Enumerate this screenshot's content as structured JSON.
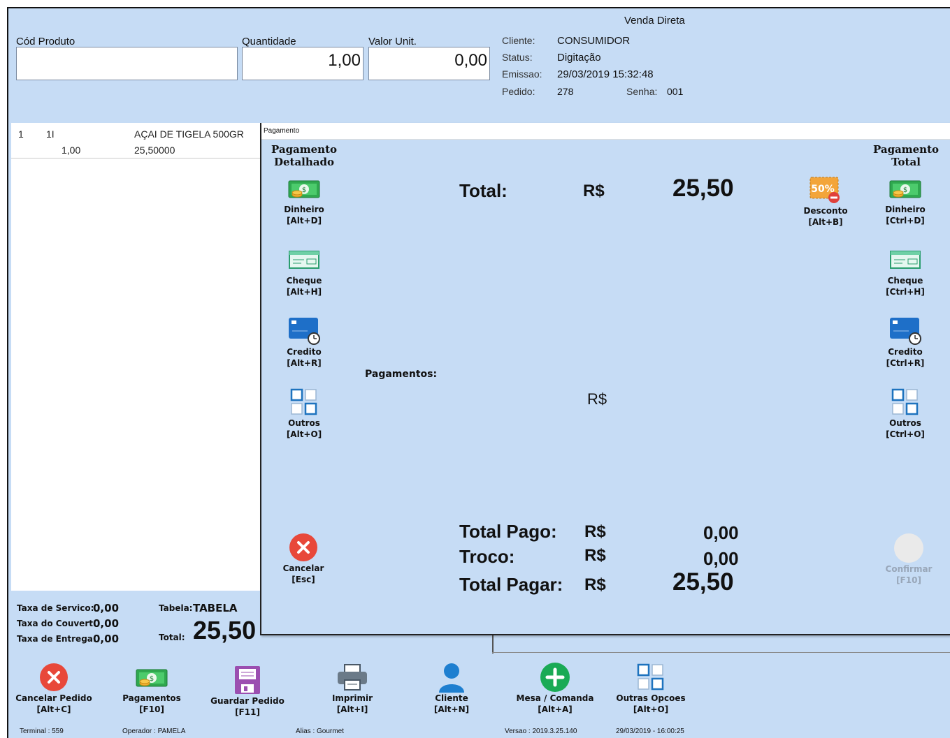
{
  "header": {
    "title": "Venda Direta",
    "cod_produto_label": "Cód Produto",
    "quantidade_label": "Quantidade",
    "quantidade_value": "1,00",
    "valor_label": "Valor Unit.",
    "valor_value": "0,00"
  },
  "info": {
    "cliente_label": "Cliente:",
    "cliente_value": "CONSUMIDOR",
    "status_label": "Status:",
    "status_value": "Digitação",
    "emissao_label": "Emissao:",
    "emissao_value": "29/03/2019 15:32:48",
    "pedido_label": "Pedido:",
    "pedido_value": "278",
    "senha_label": "Senha:",
    "senha_value": "001"
  },
  "items": [
    {
      "num": "1",
      "code": "1I",
      "desc": "AÇAI DE TIGELA 500GR",
      "qty": "1,00",
      "price": "25,50000"
    }
  ],
  "summary": {
    "taxa_servico_label": "Taxa de Servico:",
    "taxa_servico_value": "0,00",
    "taxa_couvert_label": "Taxa do Couvert:",
    "taxa_couvert_value": "0,00",
    "taxa_entrega_label": "Taxa de Entrega:",
    "taxa_entrega_value": "0,00",
    "tabela_label": "Tabela:",
    "tabela_value": "TABELA",
    "total_label": "Total:",
    "total_value": "25,50"
  },
  "dialog": {
    "window_title": "Pagamento",
    "left_title": "Pagamento\nDetalhado",
    "right_title": "Pagamento\nTotal",
    "left_buttons": [
      {
        "name": "Dinheiro",
        "key": "[Alt+D]",
        "icon": "cash-icon"
      },
      {
        "name": "Cheque",
        "key": "[Alt+H]",
        "icon": "check-icon"
      },
      {
        "name": "Credito",
        "key": "[Alt+R]",
        "icon": "credit-card-icon"
      },
      {
        "name": "Outros",
        "key": "[Alt+O]",
        "icon": "grid-icon"
      }
    ],
    "right_buttons": [
      {
        "name": "Dinheiro",
        "key": "[Ctrl+D]",
        "icon": "cash-icon"
      },
      {
        "name": "Cheque",
        "key": "[Ctrl+H]",
        "icon": "check-icon"
      },
      {
        "name": "Credito",
        "key": "[Ctrl+R]",
        "icon": "credit-card-icon"
      },
      {
        "name": "Outros",
        "key": "[Ctrl+O]",
        "icon": "grid-icon"
      }
    ],
    "desconto": {
      "name": "Desconto",
      "key": "[Alt+B]",
      "icon": "discount-icon",
      "badge": "50%"
    },
    "total_label": "Total:",
    "currency": "R$",
    "total_value": "25,50",
    "pagamentos_label": "Pagamentos:",
    "total_pago_label": "Total Pago:",
    "total_pago_value": "0,00",
    "troco_label": "Troco:",
    "troco_value": "0,00",
    "total_pagar_label": "Total Pagar:",
    "total_pagar_value": "25,50",
    "cancelar": {
      "name": "Cancelar",
      "key": "[Esc]"
    },
    "confirmar": {
      "name": "Confirmar",
      "key": "[F10]"
    }
  },
  "toolbar": [
    {
      "name": "Cancelar Pedido",
      "key": "[Alt+C]",
      "icon": "cancel-icon"
    },
    {
      "name": "Pagamentos",
      "key": "[F10]",
      "icon": "cash-icon"
    },
    {
      "name": "Guardar Pedido",
      "key": "[F11]",
      "icon": "save-icon"
    },
    {
      "name": "Imprimir",
      "key": "[Alt+I]",
      "icon": "printer-icon"
    },
    {
      "name": "Cliente",
      "key": "[Alt+N]",
      "icon": "user-icon"
    },
    {
      "name": "Mesa / Comanda",
      "key": "[Alt+A]",
      "icon": "add-icon"
    },
    {
      "name": "Outras Opcoes",
      "key": "[Alt+O]",
      "icon": "grid-icon"
    }
  ],
  "status": {
    "terminal": "Terminal : 559",
    "operador": "Operador : PAMELA",
    "alias": "Alias : Gourmet",
    "versao": "Versao : 2019.3.25.140",
    "datetime": "29/03/2019 - 16:00:25"
  },
  "colors": {
    "background": "#c6dcf5",
    "cancel": "#e8483a",
    "confirm_disabled": "#eaeaea",
    "add": "#1aaa55",
    "accent": "#1e7fd0"
  }
}
